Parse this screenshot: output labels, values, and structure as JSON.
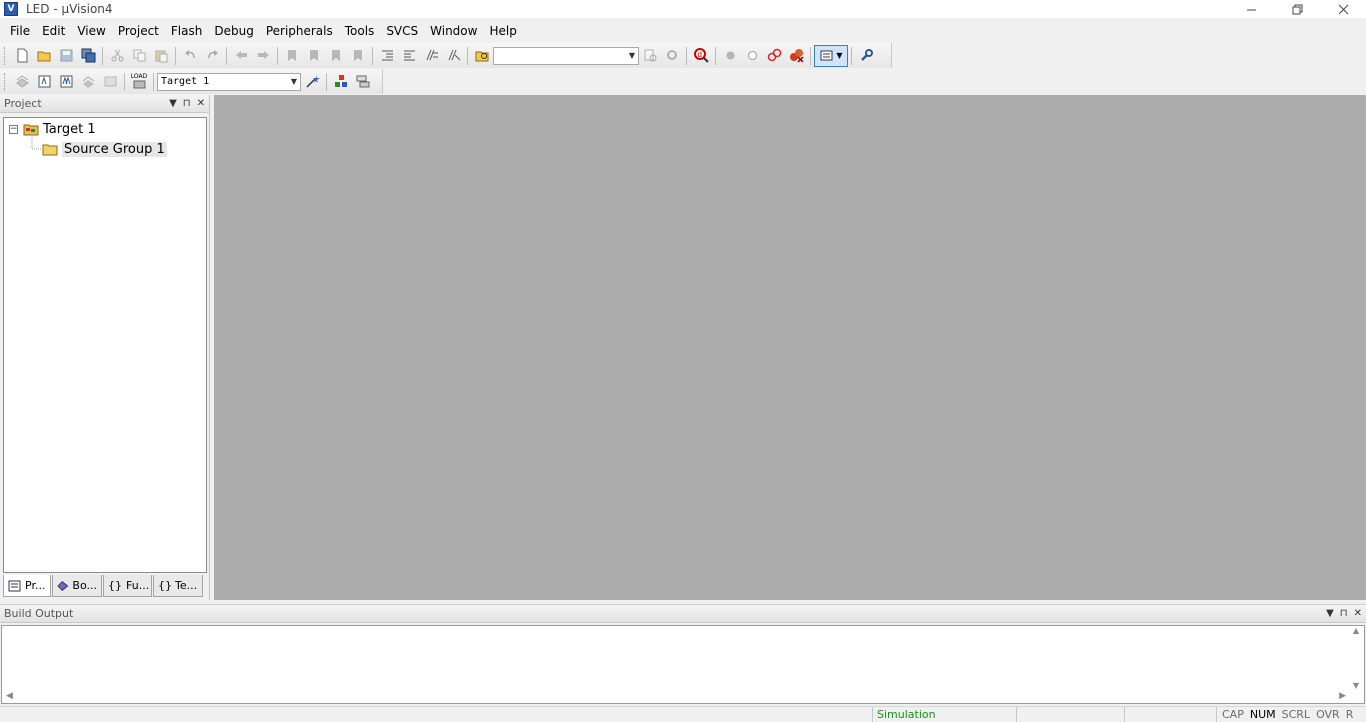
{
  "window": {
    "title": "LED  - µVision4",
    "app_icon_text": "V",
    "controls": [
      "minimize",
      "restore",
      "close"
    ]
  },
  "menu": {
    "items": [
      {
        "label": "File"
      },
      {
        "label": "Edit"
      },
      {
        "label": "View"
      },
      {
        "label": "Project"
      },
      {
        "label": "Flash"
      },
      {
        "label": "Debug"
      },
      {
        "label": "Peripherals"
      },
      {
        "label": "Tools"
      },
      {
        "label": "SVCS"
      },
      {
        "label": "Window"
      },
      {
        "label": "Help"
      }
    ]
  },
  "toolbar": {
    "find_combo_value": "",
    "target_combo_value": "Target 1",
    "load_label": "LOAD"
  },
  "project_panel": {
    "title": "Project",
    "tree": {
      "root_label": "Target 1",
      "group_label": "Source Group 1",
      "expander": "−"
    },
    "tabs": [
      {
        "label": "Pr..."
      },
      {
        "label": "Bo..."
      },
      {
        "label": "Fu..."
      },
      {
        "label": "Te..."
      }
    ]
  },
  "build_output": {
    "title": "Build Output"
  },
  "status": {
    "mode": "Simulation",
    "flags": [
      {
        "label": "CAP",
        "active": false
      },
      {
        "label": "NUM",
        "active": true
      },
      {
        "label": "SCRL",
        "active": false
      },
      {
        "label": "OVR",
        "active": false
      },
      {
        "label": "R /W",
        "active": false
      }
    ]
  },
  "colors": {
    "editor_background": "#ababab",
    "status_simulation": "#1a8f1a",
    "accent_blue": "#3c7fb1"
  }
}
